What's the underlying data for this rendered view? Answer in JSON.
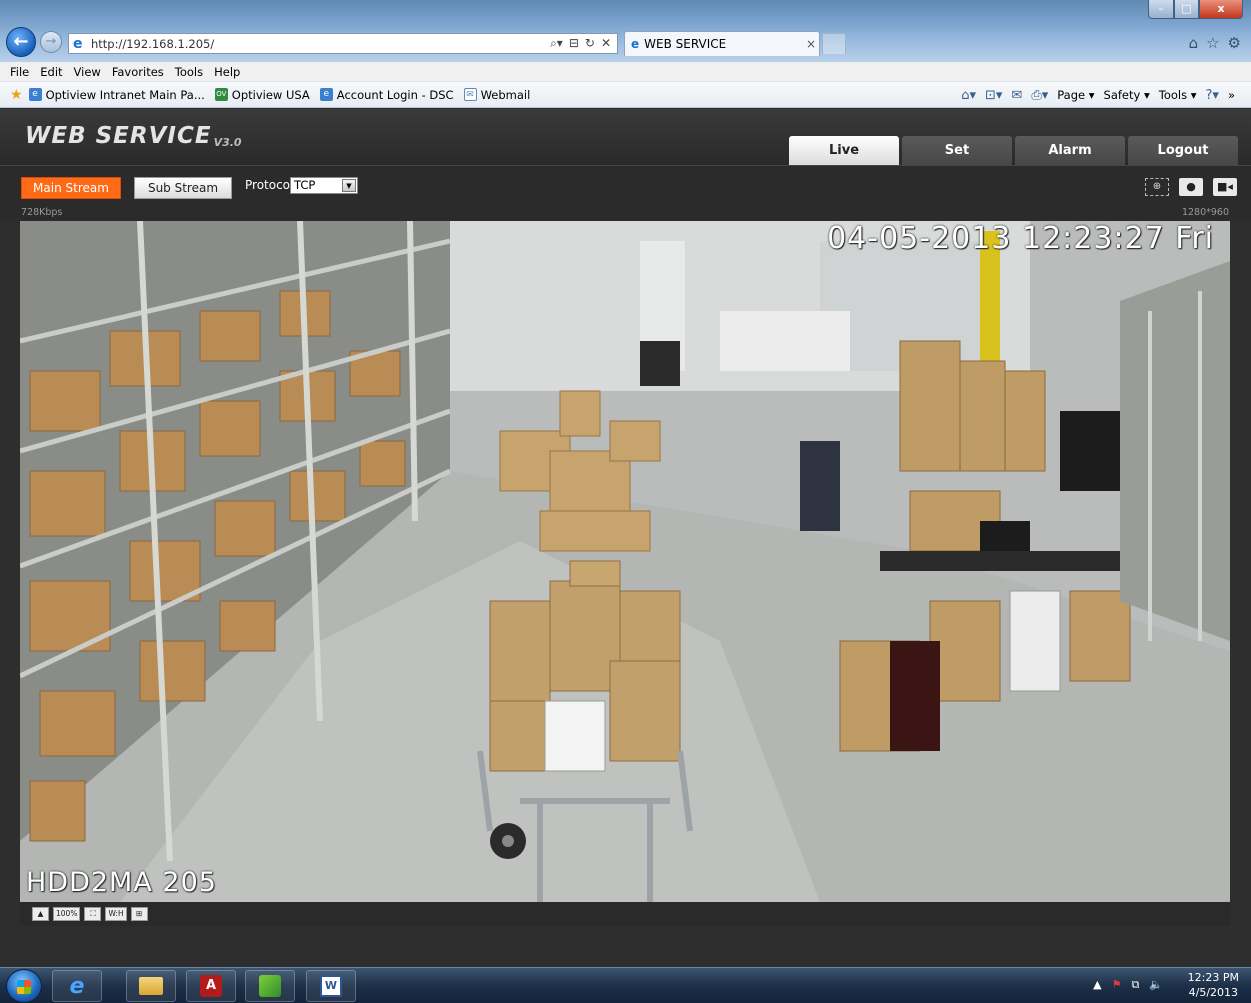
{
  "browser": {
    "url": "http://192.168.1.205/",
    "tab_title": "WEB SERVICE",
    "tab_close": "×",
    "addr_tools": [
      "⌕▾",
      "⊟",
      "↻",
      "✕"
    ],
    "window_controls": {
      "minimize": "–",
      "maximize": "□",
      "close": "x"
    },
    "menu": [
      "File",
      "Edit",
      "View",
      "Favorites",
      "Tools",
      "Help"
    ],
    "favorites": [
      {
        "label": "Optiview Intranet Main Pa...",
        "icon": "ie-page-icon"
      },
      {
        "label": "Optiview USA",
        "icon": "optiview-icon"
      },
      {
        "label": "Account Login - DSC",
        "icon": "ie-page-icon"
      },
      {
        "label": "Webmail",
        "icon": "mail-icon"
      }
    ],
    "command_bar": {
      "page": "Page ▾",
      "safety": "Safety ▾",
      "tools": "Tools ▾",
      "help": "?▾",
      "chevron": "»"
    }
  },
  "app": {
    "logo": "WEB  SERVICE",
    "logo_version": "V3.0",
    "nav": [
      {
        "label": "Live",
        "active": true
      },
      {
        "label": "Set",
        "active": false
      },
      {
        "label": "Alarm",
        "active": false
      },
      {
        "label": "Logout",
        "active": false
      }
    ],
    "toolbar": {
      "main_stream": "Main Stream",
      "sub_stream": "Sub Stream",
      "protocol_label": "Protocol",
      "protocol_value": "TCP"
    },
    "bitrate": "728Kbps",
    "resolution": "1280*960",
    "osd_timestamp": "04-05-2013 12:23:27 Fri",
    "osd_camera_name": "HDD2MA  205",
    "video_buttons": [
      "▲",
      "100%",
      "⛶",
      "W:H",
      "⊞"
    ]
  },
  "taskbar": {
    "time": "12:23 PM",
    "date": "4/5/2013",
    "tray": [
      "▲",
      "⚑",
      "⧉",
      "🔈"
    ]
  },
  "colors": {
    "accent_orange": "#ff6a17",
    "header_dark": "#2e2e2e"
  }
}
